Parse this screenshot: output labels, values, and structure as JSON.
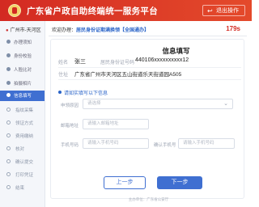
{
  "header": {
    "title": "广东省户政自助终端统一服务平台",
    "exit_label": "退出操作",
    "exit_icon": "exit-arrow-icon"
  },
  "sidebar": {
    "location": "广州市-天河区",
    "items": [
      {
        "label": "办理须知",
        "state": "done"
      },
      {
        "label": "身份校验",
        "state": "done"
      },
      {
        "label": "人脸比对",
        "state": "done"
      },
      {
        "label": "拍摄相片",
        "state": "done"
      },
      {
        "label": "信息填写",
        "state": "active"
      },
      {
        "label": "指纹采集",
        "state": "pending"
      },
      {
        "label": "领证方式",
        "state": "pending"
      },
      {
        "label": "费用缴纳",
        "state": "pending"
      },
      {
        "label": "核对",
        "state": "pending"
      },
      {
        "label": "确认提交",
        "state": "pending"
      },
      {
        "label": "打印凭证",
        "state": "pending"
      },
      {
        "label": "结束",
        "state": "pending"
      }
    ]
  },
  "breadcrumb": {
    "prefix": "欢迎办理：",
    "current": "居民身份证期满换领【全国通办】"
  },
  "countdown": "179s",
  "form": {
    "title": "信息填写",
    "name_label": "姓名",
    "name_value": "张三",
    "id_label": "居民身份证号码",
    "id_value": "440106xxxxxxxxxx12",
    "address_label": "住址",
    "address_value": "广东省广州市天河区五山街道乐天街道园A505",
    "hint": "请如实填写以下信息",
    "reason_label": "申领原因",
    "reason_placeholder": "请选择",
    "email_label": "邮箱地址",
    "email_placeholder": "请输入邮箱地址",
    "phone_label": "手机号码",
    "phone_placeholder": "请输入手机号码",
    "confirm_phone_label": "确认手机号",
    "confirm_phone_placeholder": "请输入手机号码"
  },
  "buttons": {
    "prev": "上一步",
    "next": "下一步"
  },
  "footer": "主办单位：广东省公安厅",
  "colors": {
    "brand_red": "#d32a22",
    "primary_blue": "#3f6fd1",
    "countdown_red": "#d32a22"
  }
}
